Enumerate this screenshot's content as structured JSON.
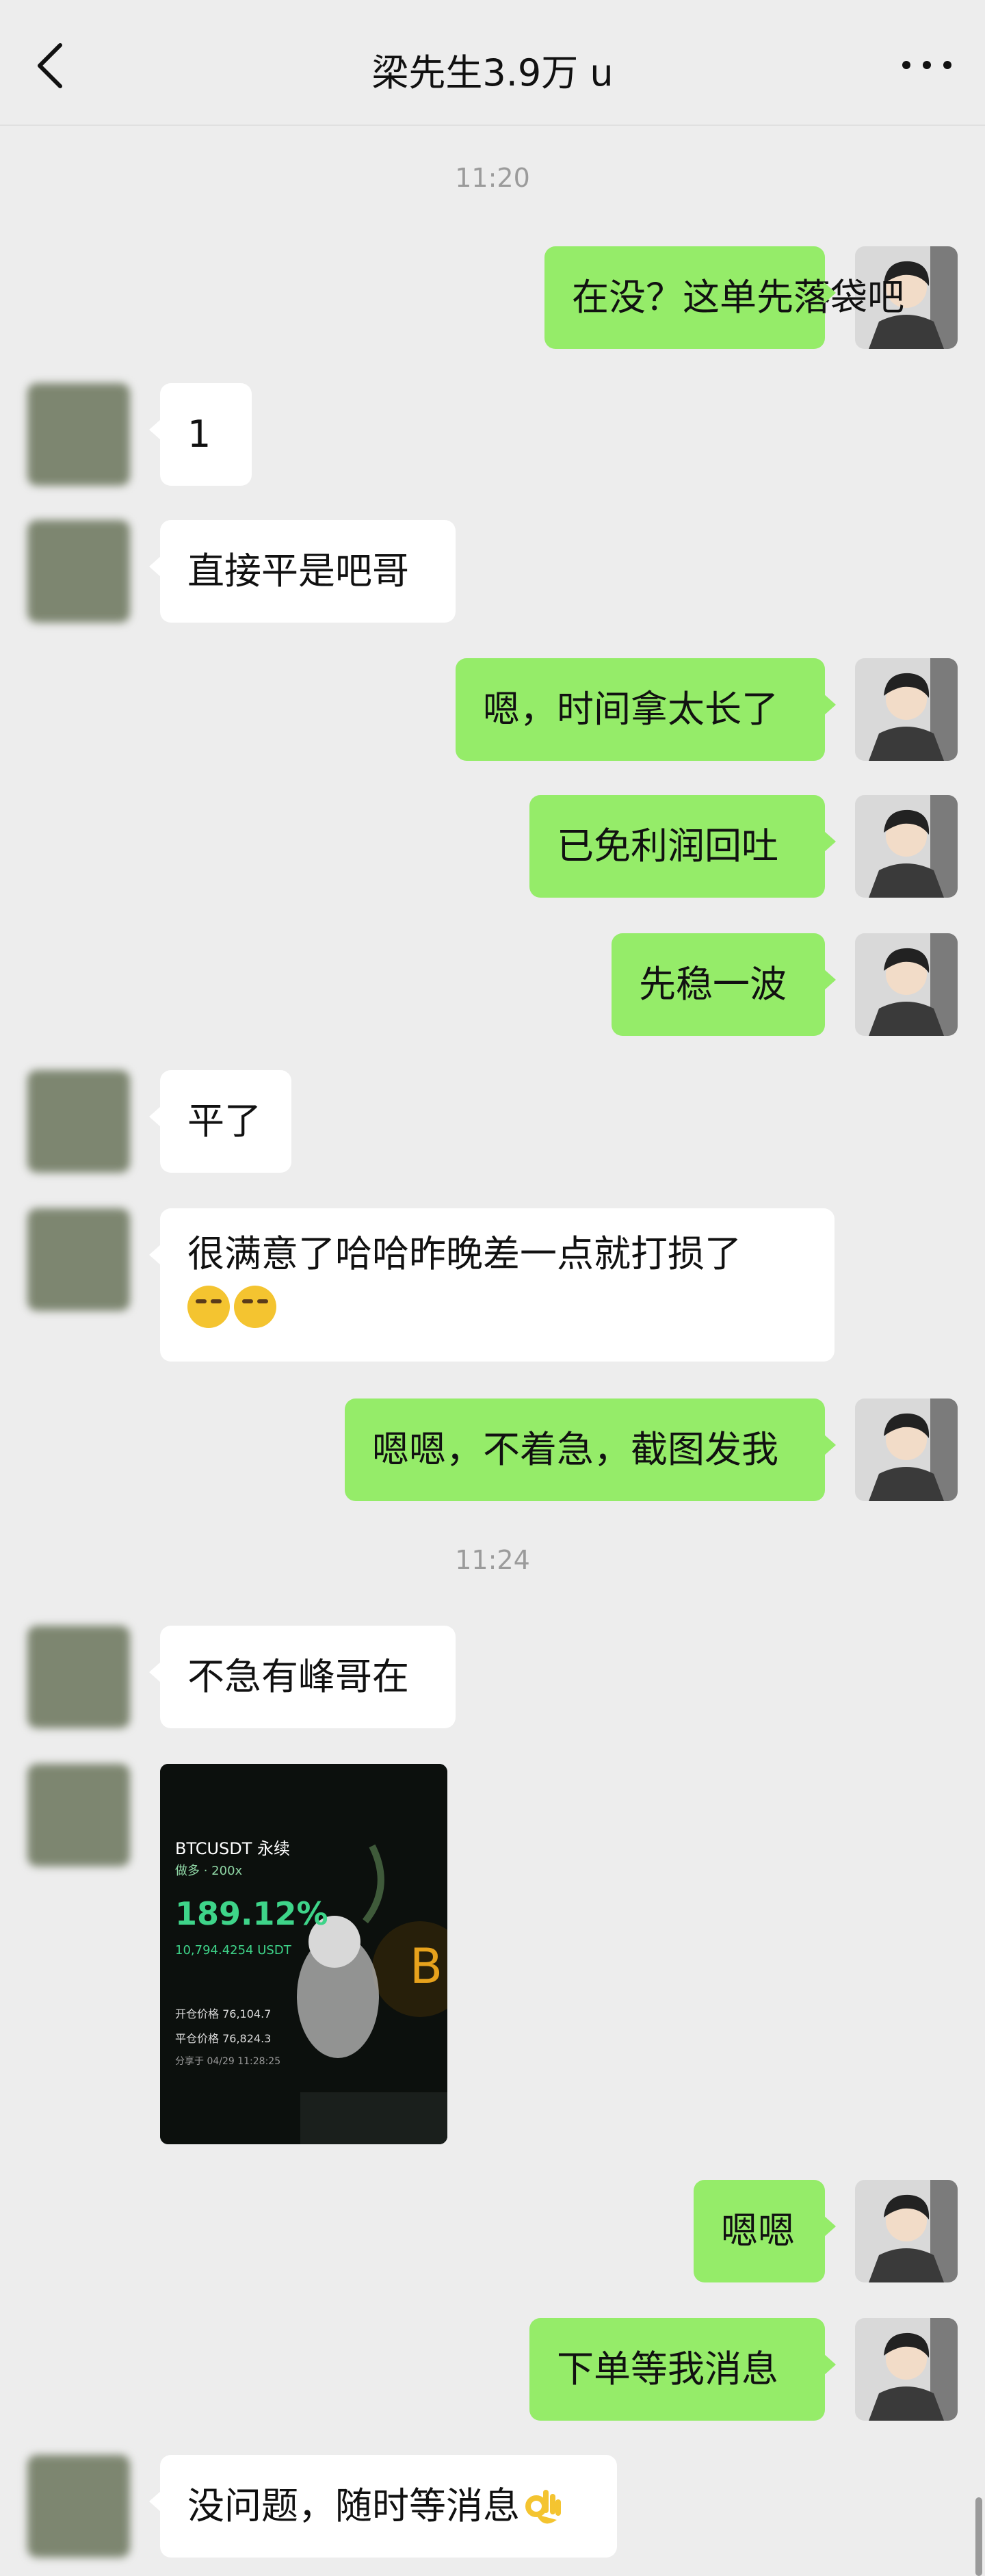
{
  "header": {
    "title": "梁先生3.9万 u"
  },
  "times": [
    "11:20",
    "11:24"
  ],
  "messages": [
    {
      "side": "me",
      "text": "在没？这单先落袋吧"
    },
    {
      "side": "other",
      "text": "1"
    },
    {
      "side": "other",
      "text": "直接平是吧哥"
    },
    {
      "side": "me",
      "text": "嗯，时间拿太长了"
    },
    {
      "side": "me",
      "text": "已免利润回吐"
    },
    {
      "side": "me",
      "text": "先稳一波"
    },
    {
      "side": "other",
      "text": "平了"
    },
    {
      "side": "other",
      "text": "很满意了哈哈昨晚差一点就打损了"
    },
    {
      "side": "me",
      "text": "嗯嗯，不着急，截图发我"
    },
    {
      "side": "other",
      "text": "不急有峰哥在"
    },
    {
      "side": "me",
      "text": "嗯嗯"
    },
    {
      "side": "me",
      "text": "下单等我消息"
    },
    {
      "side": "other",
      "text": "没问题，随时等消息"
    }
  ],
  "image_msg": {
    "pair": "BTCUSDT 永续",
    "side": "做多 · 200x",
    "pnl_pct": "189.12%",
    "pnl_amt": "10,794.4254 USDT",
    "open_price": "开仓价格 76,104.7",
    "close_price": "平仓价格 76,824.3",
    "share_time": "分享于 04/29 11:28:25"
  },
  "icons": {
    "back": "chevron-left-icon",
    "more": "more-dots-icon"
  },
  "colors": {
    "bg": "#ededed",
    "me_bubble": "#95ec69",
    "other_bubble": "#ffffff"
  }
}
